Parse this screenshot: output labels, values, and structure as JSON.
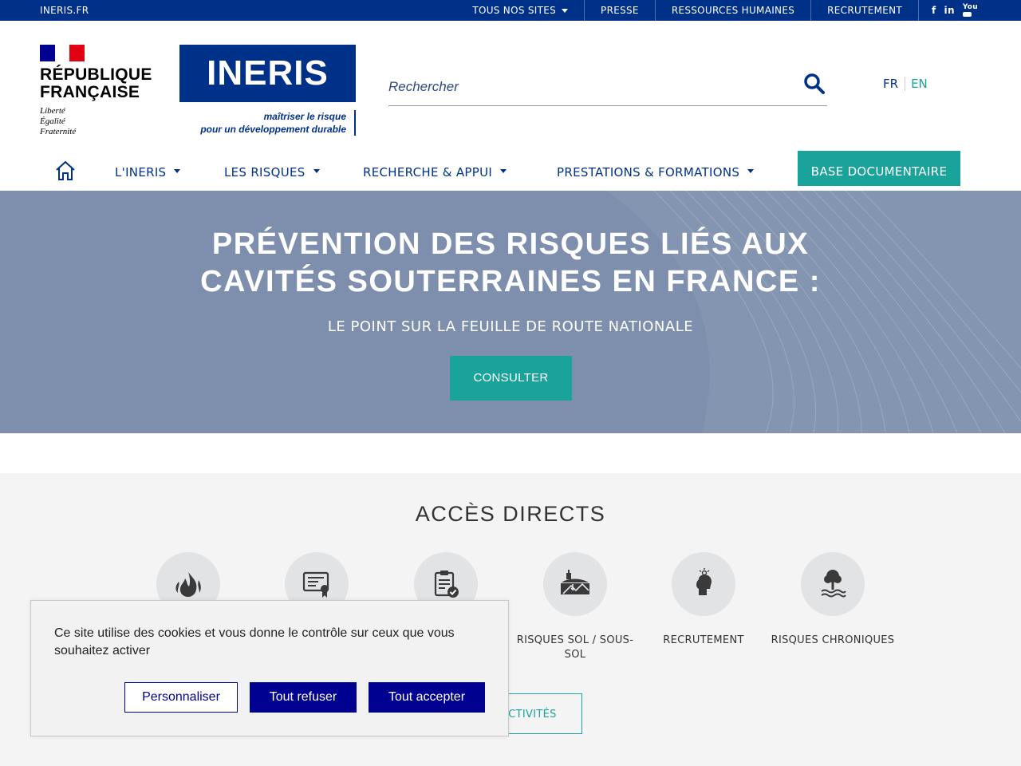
{
  "topbar": {
    "site": "INERIS.FR",
    "links": [
      "TOUS NOS SITES",
      "PRESSE",
      "RESSOURCES HUMAINES",
      "RECRUTEMENT"
    ],
    "social": [
      "f",
      "in",
      "You"
    ]
  },
  "header": {
    "rf_title_1": "RÉPUBLIQUE",
    "rf_title_2": "FRANÇAISE",
    "rf_motto": [
      "Liberté",
      "Égalité",
      "Fraternité"
    ],
    "logo_text": "INERIS",
    "tagline_1": "maîtriser le risque",
    "tagline_2": "pour un développement durable",
    "search_placeholder": "Rechercher",
    "lang": {
      "fr": "FR",
      "en": "EN"
    }
  },
  "nav": {
    "items": [
      "L'INERIS",
      "LES RISQUES",
      "RECHERCHE & APPUI",
      "PRESTATIONS & FORMATIONS"
    ],
    "base_doc": "BASE DOCUMENTAIRE"
  },
  "hero": {
    "title_1": "PRÉVENTION DES RISQUES LIÉS AUX",
    "title_2": "CAVITÉS SOUTERRAINES EN FRANCE :",
    "subtitle": "LE POINT SUR LA FEUILLE DE ROUTE NATIONALE",
    "button": "CONSULTER"
  },
  "acces": {
    "title": "ACCÈS DIRECTS",
    "tiles": [
      {
        "icon": "fire-icon",
        "label": ""
      },
      {
        "icon": "certificate-icon",
        "label": ""
      },
      {
        "icon": "clipboard-check-icon",
        "label": ""
      },
      {
        "icon": "ground-risk-icon",
        "label": "RISQUES SOL / SOUS-SOL"
      },
      {
        "icon": "head-idea-icon",
        "label": "RECRUTEMENT"
      },
      {
        "icon": "tree-water-icon",
        "label": "RISQUES CHRONIQUES"
      }
    ],
    "activites_button": "ACTIVITÉS"
  },
  "cookie": {
    "message": "Ce site utilise des cookies et vous donne le contrôle sur ceux que vous souhaitez activer",
    "personaliser": "Personnaliser",
    "refuser": "Tout refuser",
    "accepter": "Tout accepter"
  },
  "colors": {
    "primary_blue": "#003189",
    "teal": "#1aa39a",
    "hero_bg": "#7d8fad",
    "cookie_blue": "#000091"
  }
}
